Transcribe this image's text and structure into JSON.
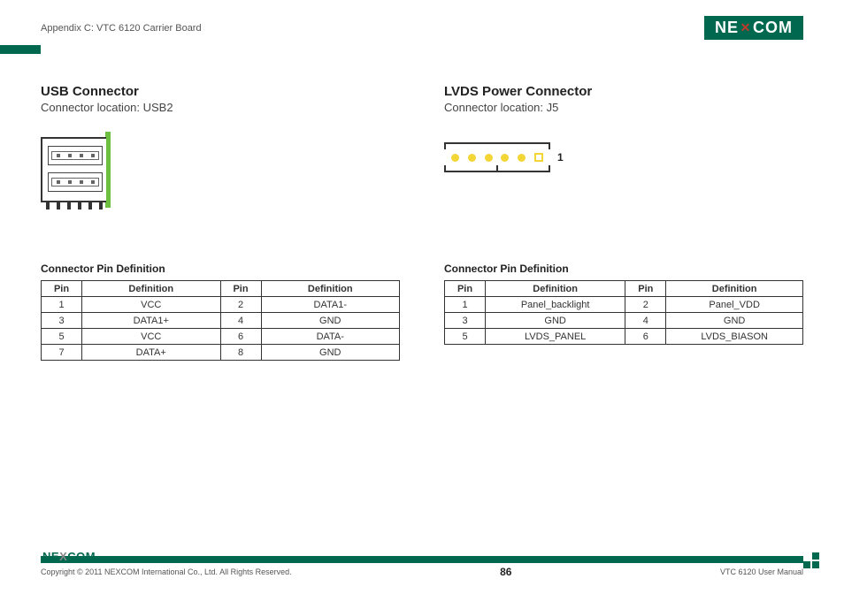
{
  "header": {
    "appendix": "Appendix C: VTC 6120 Carrier Board",
    "brand_left": "NE",
    "brand_right": "COM"
  },
  "left": {
    "title": "USB Connector",
    "subtitle": "Connector location: USB2",
    "table_title": "Connector Pin Definition",
    "headers": {
      "pin": "Pin",
      "def": "Definition"
    },
    "rows": [
      {
        "pa": "1",
        "da": "VCC",
        "pb": "2",
        "db": "DATA1-"
      },
      {
        "pa": "3",
        "da": "DATA1+",
        "pb": "4",
        "db": "GND"
      },
      {
        "pa": "5",
        "da": "VCC",
        "pb": "6",
        "db": "DATA-"
      },
      {
        "pa": "7",
        "da": "DATA+",
        "pb": "8",
        "db": "GND"
      }
    ]
  },
  "right": {
    "title": "LVDS Power Connector",
    "subtitle": "Connector location: J5",
    "pin1_label": "1",
    "table_title": "Connector Pin Definition",
    "headers": {
      "pin": "Pin",
      "def": "Definition"
    },
    "rows": [
      {
        "pa": "1",
        "da": "Panel_backlight",
        "pb": "2",
        "db": "Panel_VDD"
      },
      {
        "pa": "3",
        "da": "GND",
        "pb": "4",
        "db": "GND"
      },
      {
        "pa": "5",
        "da": "LVDS_PANEL",
        "pb": "6",
        "db": "LVDS_BIASON"
      }
    ]
  },
  "footer": {
    "brand_left": "NE",
    "brand_mid": "X",
    "brand_right": "COM",
    "copyright": "Copyright © 2011 NEXCOM International Co., Ltd. All Rights Reserved.",
    "page": "86",
    "manual": "VTC 6120 User Manual"
  }
}
